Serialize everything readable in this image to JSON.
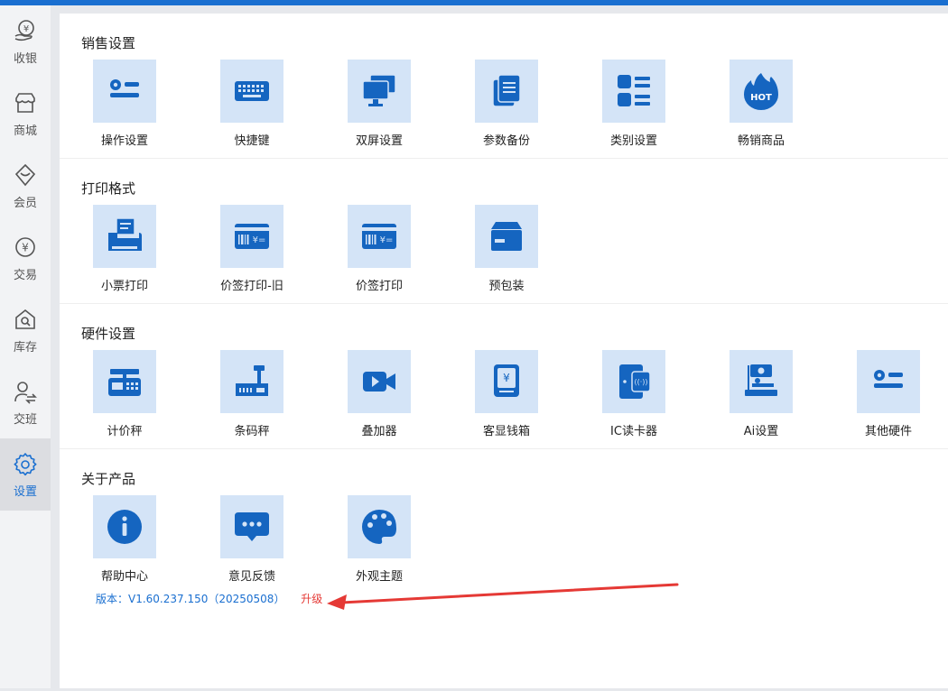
{
  "sidebar": {
    "items": [
      {
        "label": "收银",
        "icon": "cashier-icon"
      },
      {
        "label": "商城",
        "icon": "store-icon"
      },
      {
        "label": "会员",
        "icon": "member-icon"
      },
      {
        "label": "交易",
        "icon": "transaction-icon"
      },
      {
        "label": "库存",
        "icon": "inventory-icon"
      },
      {
        "label": "交班",
        "icon": "shift-handover-icon"
      },
      {
        "label": "设置",
        "icon": "settings-gear-icon",
        "active": true
      }
    ]
  },
  "sections": {
    "sales": {
      "title": "销售设置",
      "items": [
        {
          "label": "操作设置",
          "icon": "operation-settings-icon"
        },
        {
          "label": "快捷键",
          "icon": "keyboard-icon"
        },
        {
          "label": "双屏设置",
          "icon": "dual-screen-icon"
        },
        {
          "label": "参数备份",
          "icon": "backup-icon"
        },
        {
          "label": "类别设置",
          "icon": "category-list-icon"
        },
        {
          "label": "畅销商品",
          "icon": "hot-flame-icon"
        }
      ]
    },
    "print": {
      "title": "打印格式",
      "items": [
        {
          "label": "小票打印",
          "icon": "receipt-printer-icon"
        },
        {
          "label": "价签打印-旧",
          "icon": "price-tag-icon"
        },
        {
          "label": "价签打印",
          "icon": "price-tag-icon"
        },
        {
          "label": "预包装",
          "icon": "package-box-icon"
        }
      ]
    },
    "hardware": {
      "title": "硬件设置",
      "items": [
        {
          "label": "计价秤",
          "icon": "pricing-scale-icon"
        },
        {
          "label": "条码秤",
          "icon": "barcode-scale-icon"
        },
        {
          "label": "叠加器",
          "icon": "video-camera-icon"
        },
        {
          "label": "客显钱箱",
          "icon": "cash-drawer-icon"
        },
        {
          "label": "IC读卡器",
          "icon": "card-reader-icon"
        },
        {
          "label": "Ai设置",
          "icon": "ai-scale-icon"
        },
        {
          "label": "其他硬件",
          "icon": "other-hardware-icon"
        }
      ]
    },
    "about": {
      "title": "关于产品",
      "items": [
        {
          "label": "帮助中心",
          "icon": "info-icon"
        },
        {
          "label": "意见反馈",
          "icon": "feedback-chat-icon"
        },
        {
          "label": "外观主题",
          "icon": "palette-icon"
        }
      ]
    }
  },
  "version": {
    "text": "版本：V1.60.237.150（20250508）",
    "upgrade_label": "升级"
  },
  "colors": {
    "accent": "#1a6fd0",
    "tile_bg": "#d4e4f7",
    "upgrade": "#e53935",
    "arrow": "#e53935"
  }
}
